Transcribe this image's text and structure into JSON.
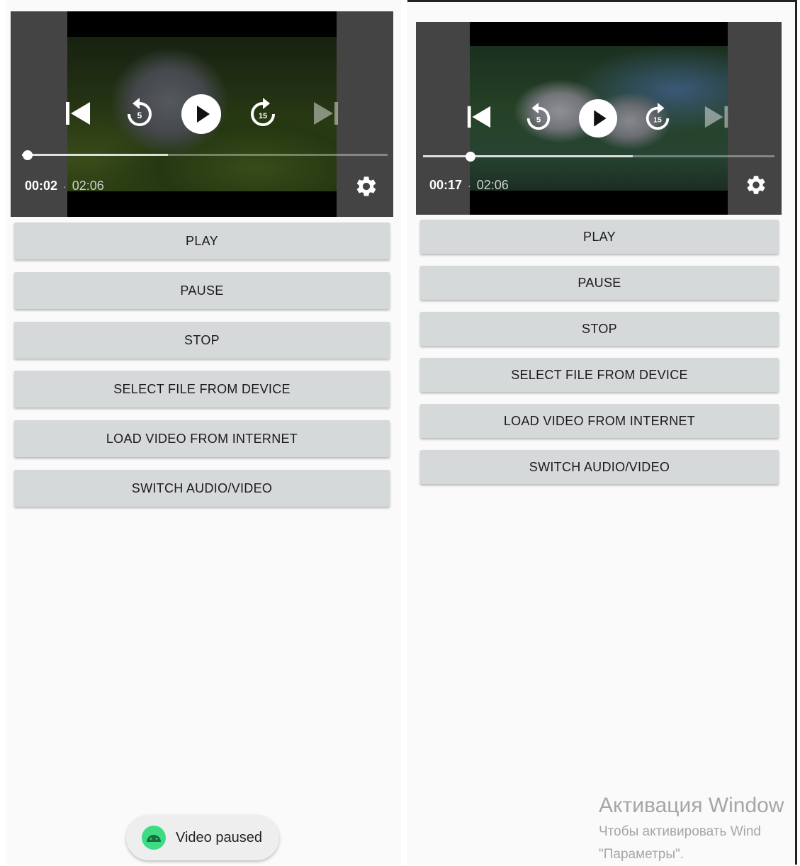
{
  "screens": [
    {
      "id": "left",
      "player": {
        "current_time": "00:02",
        "separator": "·",
        "duration": "02:06",
        "progress_fraction": 0.016
      },
      "buttons": [
        "PLAY",
        "PAUSE",
        "STOP",
        "SELECT FILE FROM DEVICE",
        "LOAD VIDEO FROM INTERNET",
        "SWITCH AUDIO/VIDEO"
      ],
      "toast": {
        "text": "Video paused",
        "icon": "android-icon",
        "icon_color": "#3ddc84"
      }
    },
    {
      "id": "right",
      "player": {
        "current_time": "00:17",
        "separator": "·",
        "duration": "02:06",
        "progress_fraction": 0.135
      }
    }
  ],
  "rewind_seconds": "5",
  "forward_seconds": "15",
  "buttons": [
    "PLAY",
    "PAUSE",
    "STOP",
    "SELECT FILE FROM DEVICE",
    "LOAD VIDEO FROM INTERNET",
    "SWITCH AUDIO/VIDEO"
  ],
  "watermark": {
    "title": "Активация Window",
    "line1": "Чтобы активировать Wind",
    "line2": "\"Параметры\"."
  },
  "colors": {
    "button_bg": "#d5d9d9",
    "screen_bg": "#fafafa",
    "player_bg": "#000000"
  }
}
